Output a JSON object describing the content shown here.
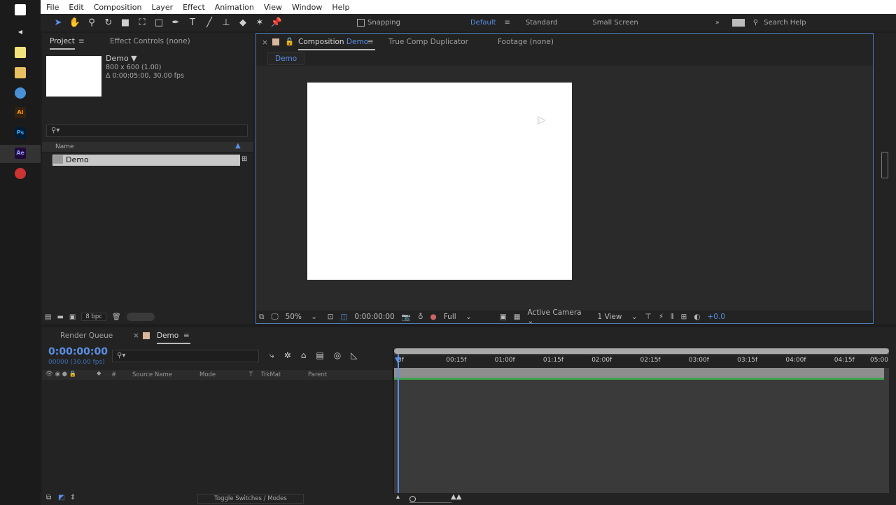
{
  "taskbar": {
    "icons": [
      "windows-icon",
      "volume-icon",
      "sticky-notes-icon",
      "file-explorer-icon",
      "chrome-icon",
      "illustrator-icon",
      "photoshop-icon",
      "after-effects-icon",
      "record-icon"
    ],
    "ai": "Ai",
    "ps": "Ps",
    "ae": "Ae"
  },
  "menu": [
    "File",
    "Edit",
    "Composition",
    "Layer",
    "Effect",
    "Animation",
    "View",
    "Window",
    "Help"
  ],
  "toolbar": {
    "snapping": "Snapping",
    "workspaces": [
      "Default",
      "Standard",
      "Small Screen"
    ],
    "search": "Search Help"
  },
  "project": {
    "tab": "Project",
    "effect_tab": "Effect Controls (none)",
    "comp_name": "Demo ▼",
    "comp_size": "800 x 600 (1.00)",
    "comp_duration": "Δ 0:00:05:00, 30.00 fps",
    "col_name": "Name",
    "items": [
      "Demo"
    ],
    "bpc": "8 bpc"
  },
  "comp": {
    "tab_prefix": "Composition",
    "tab_name": "Demo",
    "tab2": "True Comp Duplicator",
    "tab3": "Footage (none)",
    "breadcrumb": "Demo",
    "zoom": "50%",
    "time": "0:00:00:00",
    "resolution": "Full",
    "camera": "Active Camera",
    "views": "1 View",
    "exposure": "+0.0"
  },
  "timeline": {
    "render_queue": "Render Queue",
    "tab": "Demo",
    "timecode": "0:00:00:00",
    "frames": "00000 (30.00 fps)",
    "columns": [
      "#",
      "Source Name",
      "Mode",
      "T",
      "TrkMat",
      "Parent"
    ],
    "ruler": [
      "0f",
      "00:15f",
      "01:00f",
      "01:15f",
      "02:00f",
      "02:15f",
      "03:00f",
      "03:15f",
      "04:00f",
      "04:15f",
      "05:00"
    ],
    "toggle": "Toggle Switches / Modes"
  },
  "colors": {
    "accent": "#5b8fe6",
    "workarea": "#3fa24a"
  }
}
